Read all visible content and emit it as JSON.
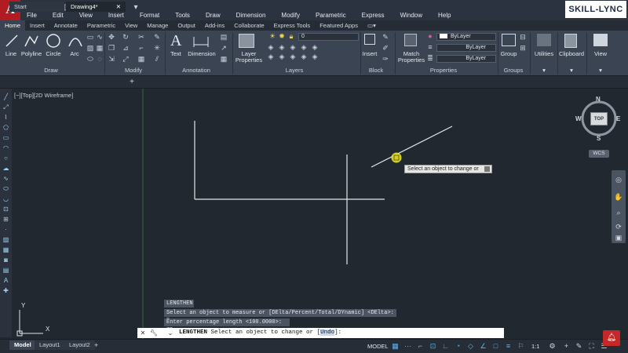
{
  "app": {
    "logo_letter": "A",
    "brand": "SKILL-LYNC"
  },
  "menubar": [
    "File",
    "Edit",
    "View",
    "Insert",
    "Format",
    "Tools",
    "Draw",
    "Dimension",
    "Modify",
    "Parametric",
    "Express",
    "Window",
    "Help"
  ],
  "ribbon_tabs": [
    "Home",
    "Insert",
    "Annotate",
    "Parametric",
    "View",
    "Manage",
    "Output",
    "Add-ins",
    "Collaborate",
    "Express Tools",
    "Featured Apps"
  ],
  "ribbon": {
    "draw_tools": [
      "Line",
      "Polyline",
      "Circle",
      "Arc"
    ],
    "text_label": "Text",
    "dimension_label": "Dimension",
    "layer_properties_label_1": "Layer",
    "layer_properties_label_2": "Properties",
    "layer_dropdown_value": "0",
    "insert_label": "Insert",
    "match_label_1": "Match",
    "match_label_2": "Properties",
    "bylayer_1": "ByLayer",
    "bylayer_2": "ByLayer",
    "bylayer_3": "ByLayer",
    "group_label": "Group",
    "utilities_label": "Utilities",
    "clipboard_label": "Clipboard",
    "view_label": "View",
    "panels": [
      "Draw",
      "Modify",
      "Annotation",
      "Layers",
      "Block",
      "Properties",
      "Groups"
    ]
  },
  "doc_tabs": {
    "start": "Start",
    "drawing": "Drawing4*"
  },
  "viewport": {
    "label": "[−][Top][2D Wireframe]"
  },
  "viewcube": {
    "n": "N",
    "s": "S",
    "e": "E",
    "w": "W",
    "top": "TOP",
    "wcs": "WCS"
  },
  "tooltip": "Select an object to change or",
  "command": {
    "history": [
      "LENGTHEN",
      "Select an object to measure or [DElta/Percent/Total/DYnamic] <DElta>: P",
      "Enter percentage length <100.0000>: 75"
    ],
    "prompt_cmd": "LENGTHEN",
    "prompt_text": "Select an object to change or [",
    "prompt_option": "Undo",
    "prompt_end": "]:"
  },
  "layout_tabs": [
    "Model",
    "Layout1",
    "Layout2"
  ],
  "status": {
    "model": "MODEL",
    "scale": "1:1"
  },
  "ucs": {
    "x": "X",
    "y": "Y"
  },
  "colors": {
    "background": "#212830",
    "ribbon": "#3b4453",
    "accent": "#b01c22",
    "cursor": "#e8e02a"
  }
}
